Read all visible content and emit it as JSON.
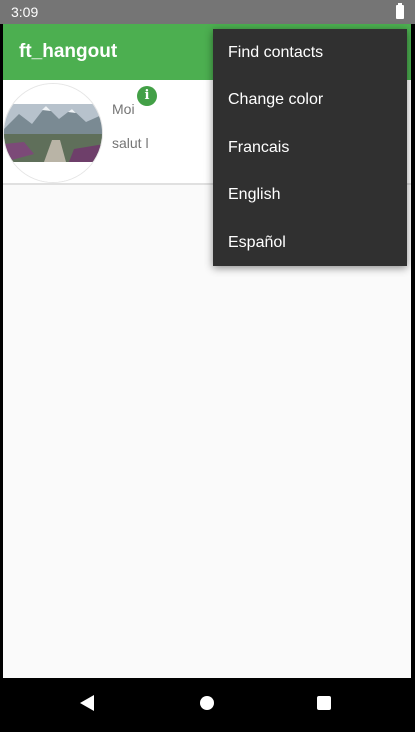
{
  "status_bar": {
    "time": "3:09"
  },
  "app_bar": {
    "title": "ft_hangout"
  },
  "contacts": [
    {
      "name": "Moi",
      "message": "salut l",
      "info_icon": "info-icon"
    }
  ],
  "menu": {
    "items": [
      "Find contacts",
      "Change color",
      "Francais",
      "English",
      "Español"
    ]
  },
  "colors": {
    "primary": "#4caf50",
    "status_bar": "#757575",
    "menu_bg": "#303030",
    "info_badge": "#43a047"
  },
  "nav_bar": {
    "icons": [
      "back-icon",
      "home-icon",
      "recents-icon"
    ]
  }
}
